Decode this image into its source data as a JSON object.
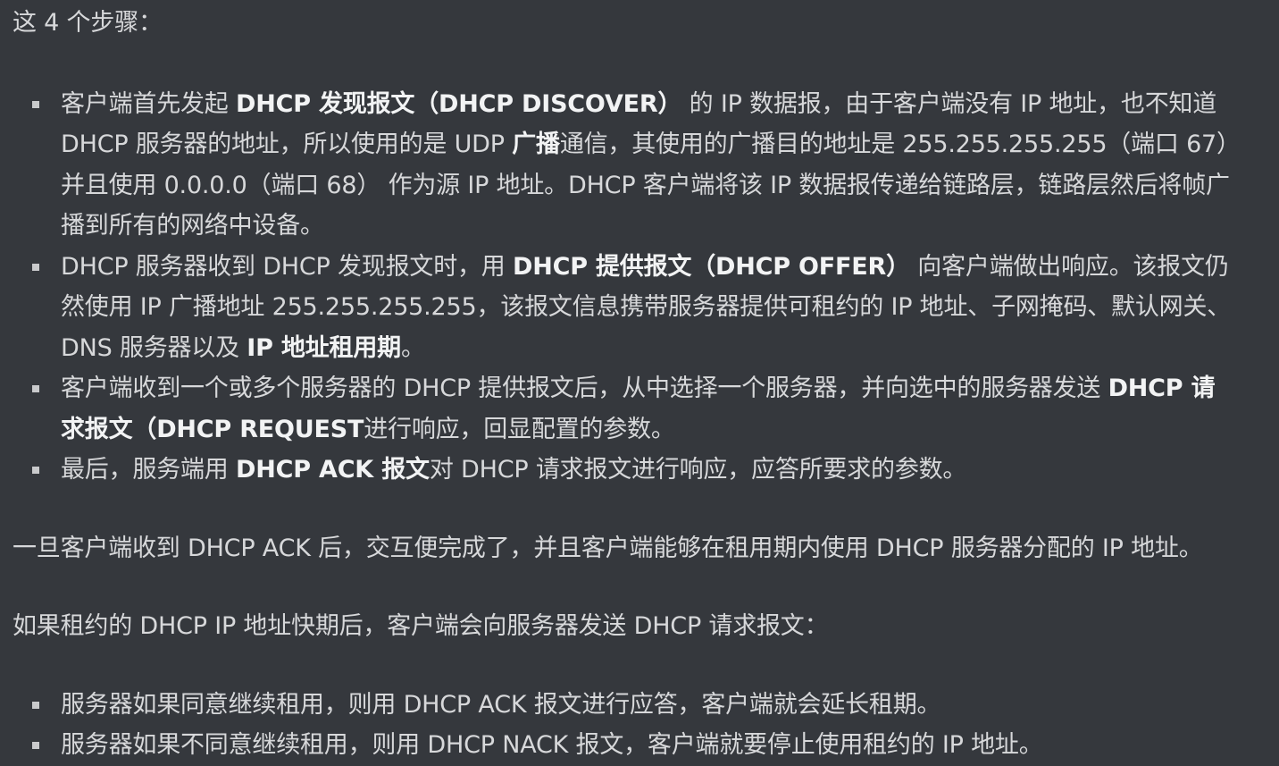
{
  "intro": "这 4 个步骤：",
  "steps": [
    {
      "lines": [
        {
          "parts": [
            {
              "t": "客户端首先发起 "
            },
            {
              "t": "DHCP 发现报文（DHCP DISCOVER）",
              "b": true
            },
            {
              "t": " 的 IP 数据报，由于客户端没有 IP 地址，也不知道"
            }
          ]
        },
        {
          "parts": [
            {
              "t": "DHCP 服务器的地址，所以使用的是 UDP "
            },
            {
              "t": "广播",
              "b": true
            },
            {
              "t": "通信，其使用的广播目的地址是 255.255.255.255（端口 67）"
            }
          ]
        },
        {
          "parts": [
            {
              "t": "并且使用 0.0.0.0（端口 68） 作为源 IP 地址。DHCP 客户端将该 IP 数据报传递给链路层，链路层然后将帧广"
            }
          ]
        },
        {
          "parts": [
            {
              "t": "播到所有的网络中设备。"
            }
          ]
        }
      ]
    },
    {
      "lines": [
        {
          "parts": [
            {
              "t": "DHCP 服务器收到 DHCP 发现报文时，用 "
            },
            {
              "t": "DHCP 提供报文（DHCP OFFER）",
              "b": true
            },
            {
              "t": " 向客户端做出响应。该报文仍"
            }
          ]
        },
        {
          "parts": [
            {
              "t": "然使用 IP 广播地址 255.255.255.255，该报文信息携带服务器提供可租约的 IP 地址、子网掩码、默认网关、"
            }
          ]
        },
        {
          "parts": [
            {
              "t": "DNS 服务器以及 "
            },
            {
              "t": "IP 地址租用期",
              "b": true
            },
            {
              "t": "。"
            }
          ]
        }
      ]
    },
    {
      "lines": [
        {
          "parts": [
            {
              "t": "客户端收到一个或多个服务器的 DHCP 提供报文后，从中选择一个服务器，并向选中的服务器发送 "
            },
            {
              "t": "DHCP 请",
              "b": true
            }
          ]
        },
        {
          "parts": [
            {
              "t": "求报文（DHCP REQUEST",
              "b": true
            },
            {
              "t": "进行响应，回显配置的参数。"
            }
          ]
        }
      ]
    },
    {
      "lines": [
        {
          "parts": [
            {
              "t": "最后，服务端用 "
            },
            {
              "t": "DHCP ACK 报文",
              "b": true
            },
            {
              "t": "对 DHCP 请求报文进行响应，应答所要求的参数。"
            }
          ]
        }
      ]
    }
  ],
  "para_ack": "一旦客户端收到 DHCP ACK 后，交互便完成了，并且客户端能够在租用期内使用 DHCP 服务器分配的 IP 地址。",
  "para_renew": "如果租约的 DHCP IP 地址快期后，客户端会向服务器发送 DHCP 请求报文：",
  "renew_items": [
    "服务器如果同意继续租用，则用 DHCP ACK 报文进行应答，客户端就会延长租期。",
    "服务器如果不同意继续租用，则用 DHCP NACK 报文，客户端就要停止使用租约的 IP 地址。"
  ]
}
